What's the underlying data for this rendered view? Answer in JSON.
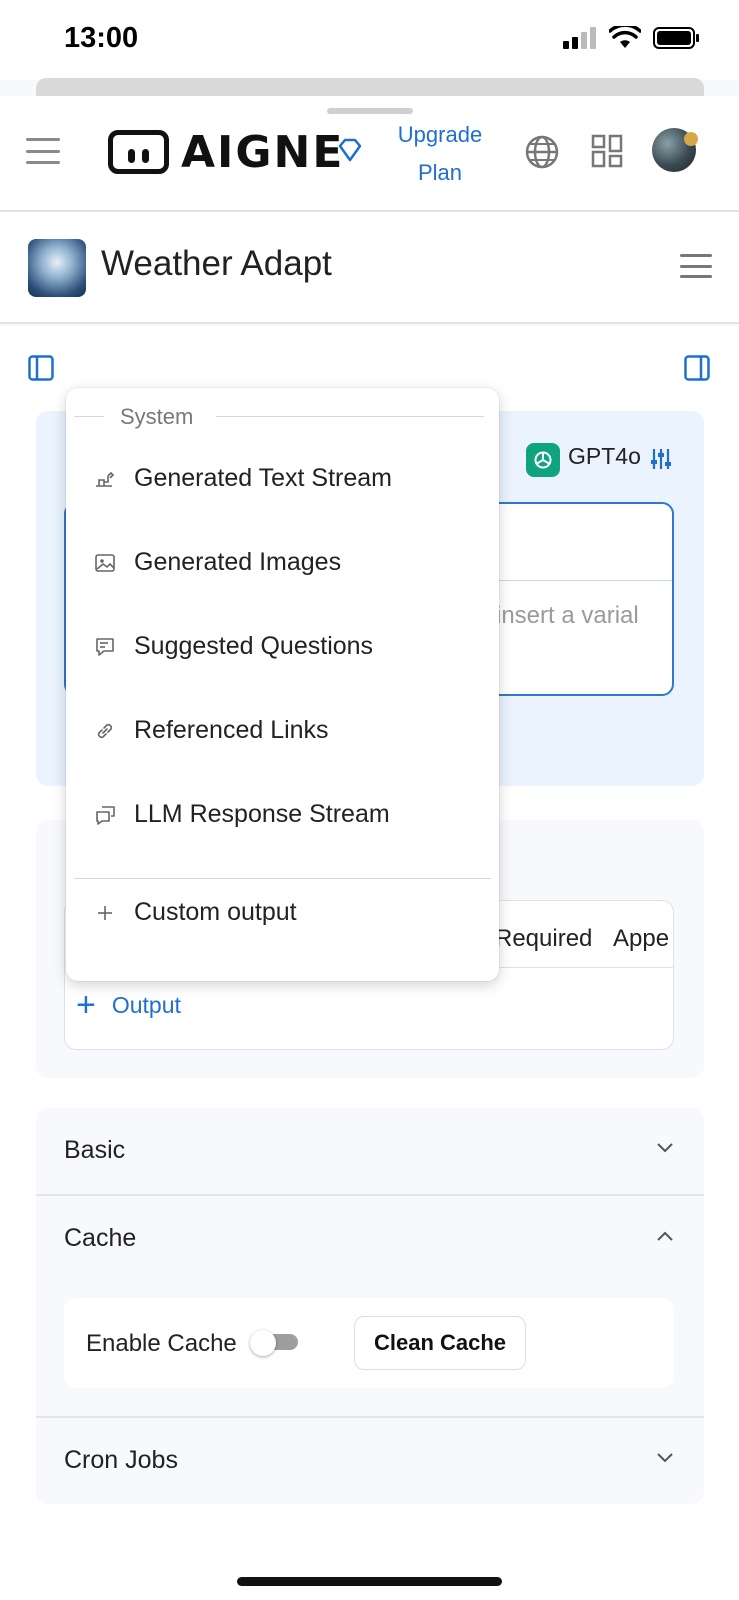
{
  "status": {
    "time": "13:00"
  },
  "header": {
    "logo_text": "AIGNE",
    "upgrade_line1": "Upgrade",
    "upgrade_line2": "Plan"
  },
  "app": {
    "title": "Weather Adapt"
  },
  "prompt": {
    "model_name": "GPT4o",
    "placeholder": "insert a varial"
  },
  "output_table": {
    "columns": [
      "Required",
      "Appe"
    ],
    "add_output_label": "Output"
  },
  "dropdown": {
    "section_label": "System",
    "items": [
      {
        "label": "Generated Text Stream",
        "icon": "text-stream-icon"
      },
      {
        "label": "Generated Images",
        "icon": "image-icon"
      },
      {
        "label": "Suggested Questions",
        "icon": "suggest-question-icon"
      },
      {
        "label": "Referenced Links",
        "icon": "link-icon"
      },
      {
        "label": "LLM Response Stream",
        "icon": "llm-stream-icon"
      }
    ],
    "custom_label": "Custom output"
  },
  "accordion": {
    "basic_label": "Basic",
    "cache_label": "Cache",
    "enable_cache_label": "Enable Cache",
    "enable_cache_on": false,
    "clean_cache_label": "Clean Cache",
    "cron_label": "Cron Jobs"
  },
  "colors": {
    "accent": "#1f6fd0",
    "gpt_green": "#10a37f",
    "panel_blue": "#eaf3fe"
  }
}
